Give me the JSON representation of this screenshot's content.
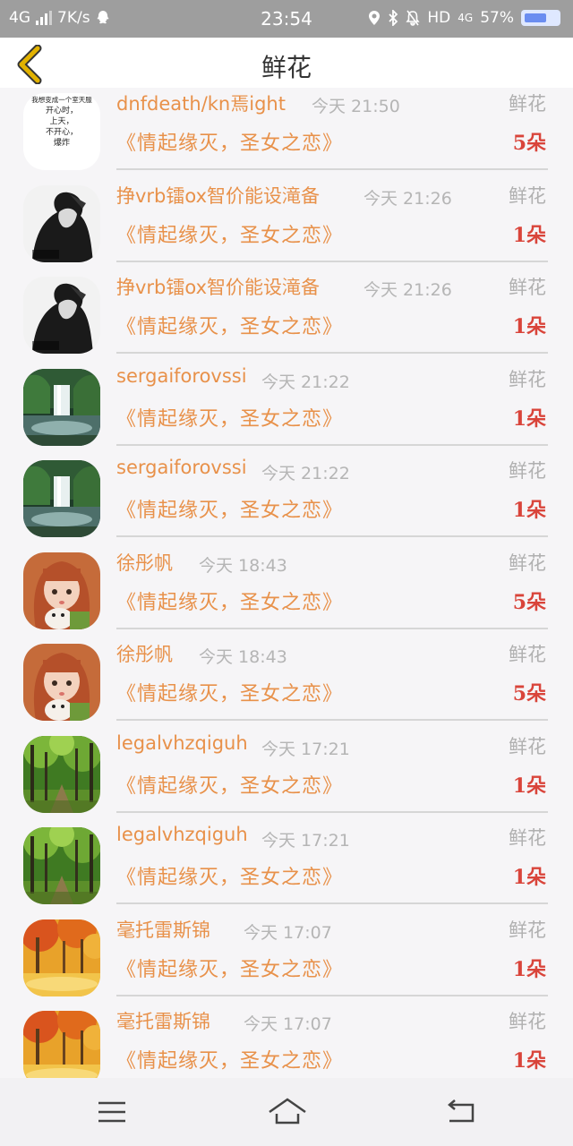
{
  "status_bar": {
    "network": "4G",
    "speed": "7K/s",
    "time": "23:54",
    "hd": "HD",
    "net2": "4G",
    "battery": "57%"
  },
  "header": {
    "title": "鲜花"
  },
  "rows": [
    {
      "name": "dnfdeath/kn焉ight",
      "time": "今天 21:50",
      "type": "鲜花",
      "book": "《情起缘灭，圣女之恋》",
      "count": "5朵",
      "avatar": "text-card"
    },
    {
      "name": "挣vrb镭ox智价能设滝备",
      "time": "今天 21:26",
      "type": "鲜花",
      "book": "《情起缘灭，圣女之恋》",
      "count": "1朵",
      "avatar": "girl-bw"
    },
    {
      "name": "挣vrb镭ox智价能设滝备",
      "time": "今天 21:26",
      "type": "鲜花",
      "book": "《情起缘灭，圣女之恋》",
      "count": "1朵",
      "avatar": "girl-bw"
    },
    {
      "name": "sergaiforovssi",
      "time": "今天 21:22",
      "type": "鲜花",
      "book": "《情起缘灭，圣女之恋》",
      "count": "1朵",
      "avatar": "waterfall"
    },
    {
      "name": "sergaiforovssi",
      "time": "今天 21:22",
      "type": "鲜花",
      "book": "《情起缘灭，圣女之恋》",
      "count": "1朵",
      "avatar": "waterfall"
    },
    {
      "name": "徐彤帆",
      "time": "今天 18:43",
      "type": "鲜花",
      "book": "《情起缘灭，圣女之恋》",
      "count": "5朵",
      "avatar": "doll"
    },
    {
      "name": "徐彤帆",
      "time": "今天 18:43",
      "type": "鲜花",
      "book": "《情起缘灭，圣女之恋》",
      "count": "5朵",
      "avatar": "doll"
    },
    {
      "name": "legalvhzqiguh",
      "time": "今天 17:21",
      "type": "鲜花",
      "book": "《情起缘灭，圣女之恋》",
      "count": "1朵",
      "avatar": "forest"
    },
    {
      "name": "legalvhzqiguh",
      "time": "今天 17:21",
      "type": "鲜花",
      "book": "《情起缘灭，圣女之恋》",
      "count": "1朵",
      "avatar": "forest"
    },
    {
      "name": "毫托雷斯锦",
      "time": "今天 17:07",
      "type": "鲜花",
      "book": "《情起缘灭，圣女之恋》",
      "count": "1朵",
      "avatar": "autumn"
    },
    {
      "name": "毫托雷斯锦",
      "time": "今天 17:07",
      "type": "鲜花",
      "book": "《情起缘灭，圣女之恋》",
      "count": "1朵",
      "avatar": "autumn"
    }
  ],
  "text_card": {
    "lines": [
      "我想变",
      "我想变成一个室天服",
      "开心时，",
      "上天，",
      "不开心，",
      "爆炸"
    ]
  },
  "colors": {
    "accent": "#e8914a",
    "count": "#d9443a",
    "muted": "#b0b0b0",
    "back_arrow": "#e2b200"
  },
  "icons": {
    "back": "chevron-left-icon",
    "menu": "menu-icon",
    "home": "home-icon",
    "return": "back-icon"
  }
}
